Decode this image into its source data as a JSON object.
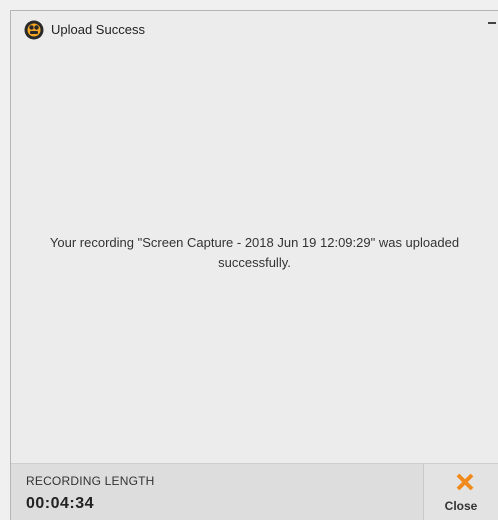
{
  "window": {
    "title": "Upload Success",
    "icon": "app-logo-icon",
    "minimize_icon": "minimize-icon"
  },
  "main": {
    "message": "Your recording \"Screen Capture - 2018 Jun 19 12:09:29\" was uploaded successfully."
  },
  "footer": {
    "recording_length_label": "RECORDING LENGTH",
    "recording_length_value": "00:04:34",
    "close_label": "Close",
    "close_icon": "close-x-icon"
  },
  "colors": {
    "close_accent": "#f08a1c",
    "logo_dark": "#2a2a2a",
    "logo_accent": "#f5a623"
  }
}
